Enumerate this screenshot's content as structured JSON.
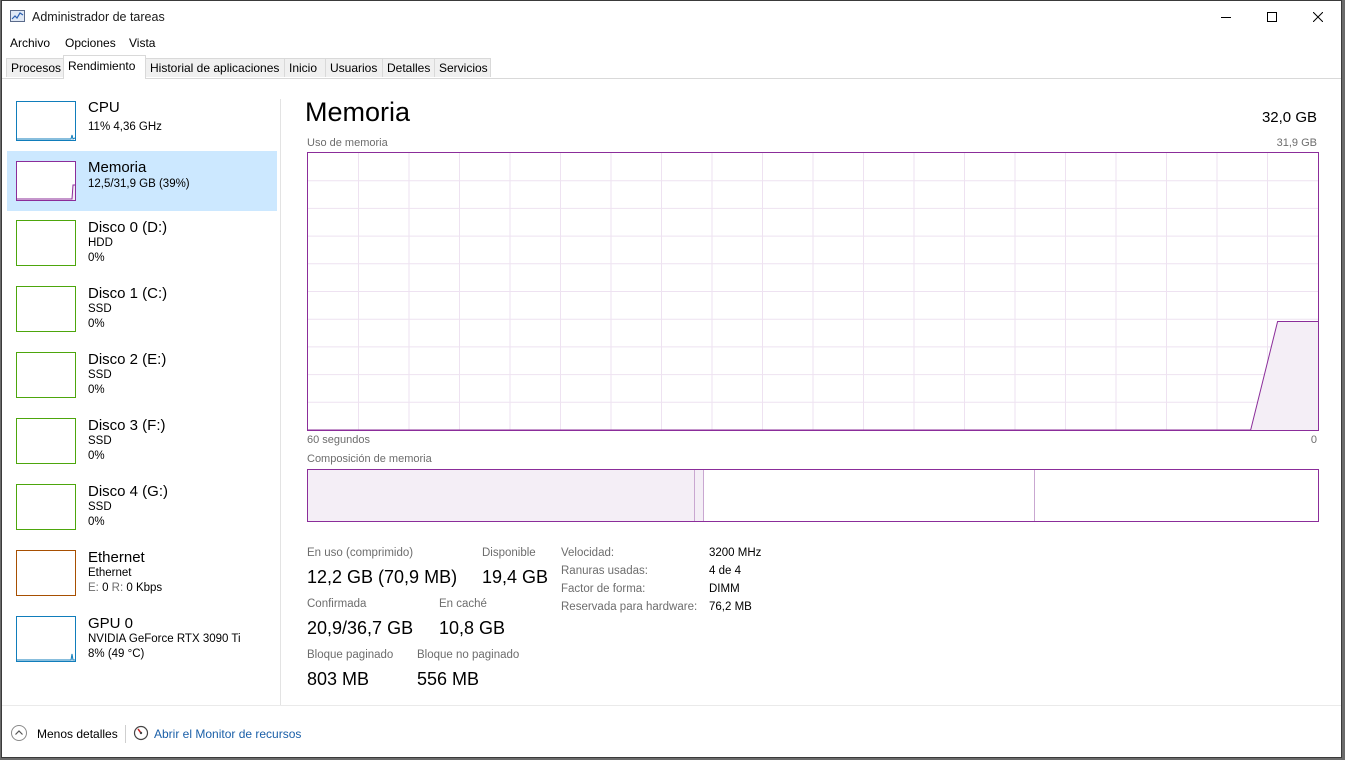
{
  "window": {
    "title": "Administrador de tareas"
  },
  "menu": [
    "Archivo",
    "Opciones",
    "Vista"
  ],
  "tabs": [
    "Procesos",
    "Rendimiento",
    "Historial de aplicaciones",
    "Inicio",
    "Usuarios",
    "Detalles",
    "Servicios"
  ],
  "active_tab": "Rendimiento",
  "sidebar": [
    {
      "title": "CPU",
      "line1": "11%  4,36 GHz",
      "color": "#117dbb"
    },
    {
      "title": "Memoria",
      "line1": "12,5/31,9 GB (39%)",
      "color": "#8b2d9a",
      "selected": true
    },
    {
      "title": "Disco 0 (D:)",
      "line1": "HDD",
      "line2": "0%",
      "color": "#4da60c"
    },
    {
      "title": "Disco 1 (C:)",
      "line1": "SSD",
      "line2": "0%",
      "color": "#4da60c"
    },
    {
      "title": "Disco 2 (E:)",
      "line1": "SSD",
      "line2": "0%",
      "color": "#4da60c"
    },
    {
      "title": "Disco 3 (F:)",
      "line1": "SSD",
      "line2": "0%",
      "color": "#4da60c"
    },
    {
      "title": "Disco 4 (G:)",
      "line1": "SSD",
      "line2": "0%",
      "color": "#4da60c"
    },
    {
      "title": "Ethernet",
      "line1": "Ethernet",
      "line2_prefix_s": "E:",
      "line2_val_s": " 0 ",
      "line2_prefix_r": "R:",
      "line2_val_r": " 0 Kbps",
      "color": "#a74f01"
    },
    {
      "title": "GPU 0",
      "line1": "NVIDIA GeForce RTX 3090 Ti",
      "line2": "8%  (49 °C)",
      "color": "#117dbb"
    }
  ],
  "main": {
    "title": "Memoria",
    "total": "32,0 GB",
    "usage_label": "Uso de memoria",
    "usage_max": "31,9 GB",
    "time_left": "60 segundos",
    "time_right": "0",
    "composition_label": "Composición de memoria",
    "accent": "#8b2d9a",
    "fill": "#f4eef6"
  },
  "chart_data": {
    "type": "area",
    "title": "Uso de memoria",
    "ylim": [
      0,
      31.9
    ],
    "x": [
      60,
      4,
      2.4,
      0
    ],
    "values": [
      0,
      0,
      12.5,
      12.5
    ],
    "grid": true
  },
  "composition": {
    "in_use_fraction": 0.383,
    "modified_fraction": 0.009,
    "standby_fraction": 0.328
  },
  "stats": {
    "in_use_label": "En uso (comprimido)",
    "in_use_value": "12,2 GB (70,9 MB)",
    "available_label": "Disponible",
    "available_value": "19,4 GB",
    "committed_label": "Confirmada",
    "committed_value": "20,9/36,7 GB",
    "cached_label": "En caché",
    "cached_value": "10,8 GB",
    "paged_label": "Bloque paginado",
    "paged_value": "803 MB",
    "nonpaged_label": "Bloque no paginado",
    "nonpaged_value": "556 MB"
  },
  "specs": [
    {
      "label": "Velocidad:",
      "value": "3200 MHz"
    },
    {
      "label": "Ranuras usadas:",
      "value": "4 de 4"
    },
    {
      "label": "Factor de forma:",
      "value": "DIMM"
    },
    {
      "label": "Reservada para hardware:",
      "value": "76,2 MB"
    }
  ],
  "footer": {
    "less_details": "Menos detalles",
    "resource_monitor": "Abrir el Monitor de recursos"
  }
}
